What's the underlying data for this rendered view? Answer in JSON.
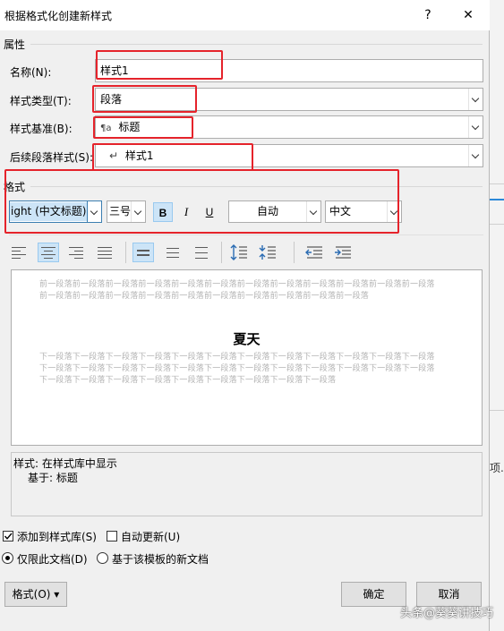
{
  "dialog": {
    "title": "根据格式化创建新样式",
    "help_glyph": "?",
    "close_glyph": "✕"
  },
  "properties": {
    "section_label": "属性",
    "name_label": "名称(N):",
    "name_value": "样式1",
    "type_label": "样式类型(T):",
    "type_value": "段落",
    "base_label": "样式基准(B):",
    "base_icon": "¶a",
    "base_value": "标题",
    "next_label": "后续段落样式(S):",
    "next_icon": "↵",
    "next_value": "样式1"
  },
  "format": {
    "section_label": "格式",
    "font_value": "ight (中文标题)",
    "size_value": "三号",
    "bold": "B",
    "italic": "I",
    "underline": "U",
    "color_value": "自动",
    "lang_value": "中文",
    "selected_alignment": "center",
    "selected_spacing": "single"
  },
  "preview": {
    "prev_para": "前一段落前一段落前一段落前一段落前一段落前一段落前一段落前一段落前一段落前一段落前一段落前一段落前一段落前一段落前一段落前一段落前一段落前一段落前一段落前一段落前一段落前一段落",
    "sample_title": "夏天",
    "next_para": "下一段落下一段落下一段落下一段落下一段落下一段落下一段落下一段落下一段落下一段落下一段落下一段落下一段落下一段落下一段落下一段落下一段落下一段落下一段落下一段落下一段落下一段落下一段落下一段落下一段落下一段落下一段落下一段落下一段落下一段落下一段落下一段落下一段落"
  },
  "description": {
    "line1": "样式: 在样式库中显示",
    "line2": "基于: 标题"
  },
  "options": {
    "add_to_gallery": "添加到样式库(S)",
    "add_to_gallery_checked": true,
    "auto_update": "自动更新(U)",
    "auto_update_checked": false,
    "only_this_doc": "仅限此文档(D)",
    "new_docs_template": "基于该模板的新文档",
    "selected_scope": "only_this_doc"
  },
  "buttons": {
    "format": "格式(O) ▾",
    "ok": "确定",
    "cancel": "取消"
  },
  "background": {
    "side_text": "项..."
  },
  "watermark": "头条@葵葵讲技巧",
  "colors": {
    "highlight_red": "#e5232b",
    "selection_blue": "#cce4f7",
    "dialog_bg": "#f0f0f0"
  }
}
